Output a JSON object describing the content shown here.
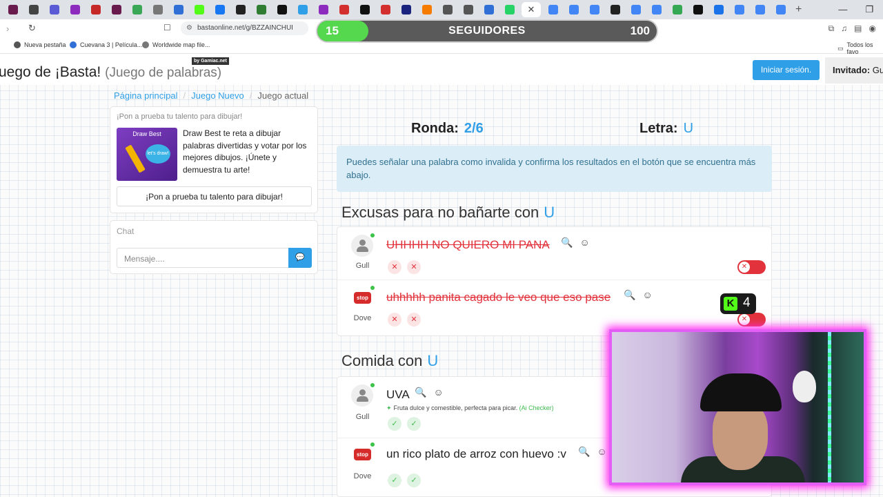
{
  "browser": {
    "active_tab_close": "✕",
    "new_tab": "+",
    "window_controls": [
      "—",
      "❐",
      "✕"
    ],
    "url": "bastaonline.net/g/BZZAINCHUI",
    "bookmarks": [
      {
        "label": "Nueva pestaña",
        "color": "#555555"
      },
      {
        "label": "Cuevana 3 | Película...",
        "color": "#2f6fd6"
      },
      {
        "label": "Worldwide map file...",
        "color": "#777777"
      }
    ],
    "bookmarks_right": "Todos los favo",
    "tab_favicon_colors": [
      "#6a1b4d",
      "#444444",
      "#5b5bd6",
      "#8e2bbf",
      "#c62828",
      "#6a1b4d",
      "#3aa757",
      "#777777",
      "#2f6fd6",
      "#53fc18",
      "#1877f2",
      "#222222",
      "#2e7d32",
      "#111111",
      "#2f9fe8",
      "#8e2bbf",
      "#d32f2f",
      "#111111",
      "#d32f2f",
      "#1a237e",
      "#f57c00",
      "#555555",
      "#555555",
      "#2f6fd6",
      "#25d366"
    ],
    "tab_favicon_colors_right": [
      "#4285f4",
      "#4285f4",
      "#4285f4",
      "#222222",
      "#4285f4",
      "#4285f4",
      "#34a853",
      "#111111",
      "#1a73e8",
      "#4285f4",
      "#4285f4",
      "#4285f4"
    ]
  },
  "header": {
    "title": "uego de ¡Basta!",
    "subtitle": "(Juego de palabras)",
    "badge": "by Gamiac.net",
    "login_button": "Iniciar sesión.",
    "guest_label": "Invitado:",
    "guest_name": "Gu"
  },
  "breadcrumb": {
    "home": "Página principal",
    "new_game": "Juego Nuevo",
    "current": "Juego actual"
  },
  "ad": {
    "title": "¡Pon a prueba tu talento para dibujar!",
    "thumb_title": "Draw Best",
    "thumb_cloud": "let's draw!",
    "description": "Draw Best te reta a dibujar palabras divertidas y votar por los mejores dibujos. ¡Únete y demuestra tu arte!",
    "button": "¡Pon a prueba tu talento para dibujar!"
  },
  "chat": {
    "title": "Chat",
    "placeholder": "Mensaje....",
    "send_icon": "💬"
  },
  "game": {
    "round_label": "Ronda:",
    "round_value": "2/6",
    "letter_label": "Letra:",
    "letter_value": "U",
    "notice": "Puedes señalar una palabra como invalida y confirma los resultados en el botón que se encuentra más abajo."
  },
  "categories": [
    {
      "title": "Excusas para no bañarte con",
      "letter": "U",
      "entries": [
        {
          "user": "Gull",
          "word": "UHHHH NO QUIERO MI PANA",
          "valid": false,
          "votes": [
            "✕",
            "✕"
          ]
        },
        {
          "user": "Dove",
          "word": "uhhhhh panita cagado le veo que eso pase",
          "valid": false,
          "votes": [
            "✕",
            "✕"
          ]
        }
      ]
    },
    {
      "title": "Comida con",
      "letter": "U",
      "entries": [
        {
          "user": "Gull",
          "word": "UVA",
          "valid": true,
          "hint": "Fruta dulce y comestible, perfecta para picar.",
          "hint_source": "(Ai Checker)",
          "votes": [
            "✓",
            "✓"
          ]
        },
        {
          "user": "Dove",
          "word": "un rico plato de arroz con huevo :v",
          "valid": true,
          "votes": [
            "✓",
            "✓"
          ]
        }
      ]
    }
  ],
  "overlay": {
    "followers_current": "15",
    "followers_label": "SEGUIDORES",
    "followers_goal": "100",
    "followers_progress": 0.15,
    "kick_count": "4",
    "kick_logo": "K"
  },
  "user_stop_sign": "stop",
  "colors": {
    "accent": "#2f9fe8",
    "invalid": "#e2333c",
    "valid": "#3dbb4d",
    "kick_green": "#53fc18",
    "cam_border": "#e35ef5"
  }
}
